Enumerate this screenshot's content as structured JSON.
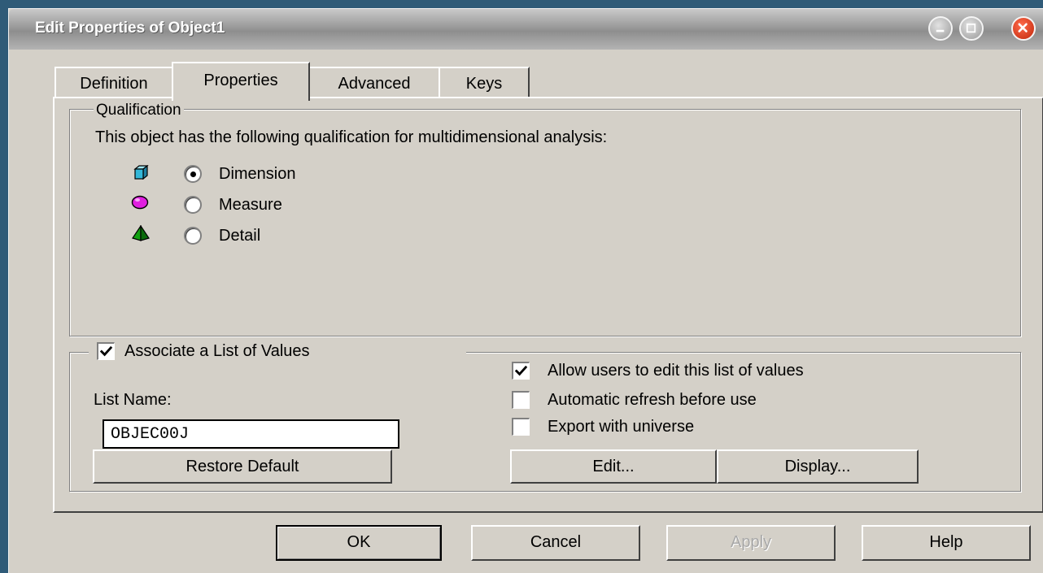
{
  "window": {
    "title": "Edit Properties of Object1"
  },
  "tabs": [
    {
      "label": "Definition"
    },
    {
      "label": "Properties"
    },
    {
      "label": "Advanced"
    },
    {
      "label": "Keys"
    }
  ],
  "active_tab": "Properties",
  "qualification": {
    "legend": "Qualification",
    "description": "This object has the following qualification for multidimensional analysis:",
    "options": [
      {
        "label": "Dimension",
        "icon": "dimension-cube-icon",
        "selected": true
      },
      {
        "label": "Measure",
        "icon": "measure-sphere-icon",
        "selected": false
      },
      {
        "label": "Detail",
        "icon": "detail-pyramid-icon",
        "selected": false
      }
    ]
  },
  "lov": {
    "associate_label": "Associate a List of Values",
    "associate_checked": true,
    "list_name_label": "List Name:",
    "list_name_value": "OBJEC00J",
    "restore_default_label": "Restore Default",
    "allow_edit_label": "Allow users to edit this list of values",
    "allow_edit_checked": true,
    "auto_refresh_label": "Automatic refresh before use",
    "auto_refresh_checked": false,
    "export_label": "Export with universe",
    "export_checked": false,
    "edit_label": "Edit...",
    "display_label": "Display..."
  },
  "footer": {
    "ok_label": "OK",
    "cancel_label": "Cancel",
    "apply_label": "Apply",
    "help_label": "Help"
  },
  "colors": {
    "dialog_face": "#d4d0c8",
    "desktop": "#2f5b78",
    "close_button": "#c0280c",
    "dimension_icon": "#33b7d8",
    "measure_icon": "#e020e0",
    "detail_icon": "#11a011"
  }
}
